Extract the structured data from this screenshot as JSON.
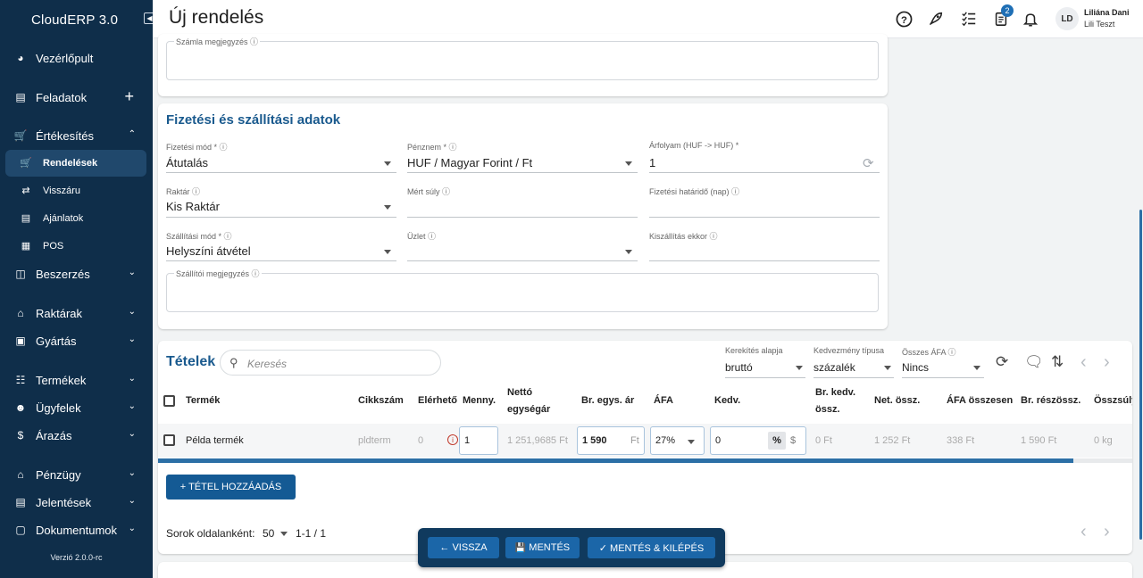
{
  "sidebar": {
    "brand": "CloudERP 3.0",
    "collapse_icon": "collapse-icon",
    "items": [
      {
        "label": "Vezérlőpult",
        "icon": "dashboard-icon"
      },
      {
        "label": "Feladatok",
        "icon": "clipboard-icon"
      },
      {
        "label": "Értékesítés",
        "icon": "cart-icon"
      },
      {
        "label": "Rendelések",
        "icon": "cart-icon"
      },
      {
        "label": "Visszáru",
        "icon": "swap-icon"
      },
      {
        "label": "Ajánlatok",
        "icon": "document-icon"
      },
      {
        "label": "POS",
        "icon": "pos-icon"
      },
      {
        "label": "Beszerzés",
        "icon": "truck-icon"
      },
      {
        "label": "Raktárak",
        "icon": "warehouse-icon"
      },
      {
        "label": "Gyártás",
        "icon": "folder-icon"
      },
      {
        "label": "Termékek",
        "icon": "products-icon"
      },
      {
        "label": "Ügyfelek",
        "icon": "people-icon"
      },
      {
        "label": "Árazás",
        "icon": "dollar-icon"
      },
      {
        "label": "Pénzügy",
        "icon": "bank-icon"
      },
      {
        "label": "Jelentések",
        "icon": "report-icon"
      },
      {
        "label": "Dokumentumok",
        "icon": "file-icon"
      }
    ],
    "version": "Verzió 2.0.0-rc"
  },
  "topbar": {
    "title": "Új rendelés",
    "badge_count": "2",
    "user_initials": "LD",
    "user_name": "Liliána Dani",
    "user_sub": "Lili Teszt"
  },
  "invoice_note": {
    "label": "Számla megjegyzés ⓘ"
  },
  "payment": {
    "title": "Fizetési és szállítási adatok",
    "fields": {
      "payment_method": {
        "label": "Fizetési mód * ⓘ",
        "value": "Átutalás"
      },
      "currency": {
        "label": "Pénznem * ⓘ",
        "value": "HUF / Magyar Forint / Ft"
      },
      "rate": {
        "label": "Árfolyam (HUF -> HUF) *",
        "value": "1"
      },
      "warehouse": {
        "label": "Raktár ⓘ",
        "value": "Kis Raktár"
      },
      "weight": {
        "label": "Mért súly ⓘ",
        "value": ""
      },
      "deadline": {
        "label": "Fizetési határidő (nap) ⓘ",
        "value": ""
      },
      "shipping_method": {
        "label": "Szállítási mód * ⓘ",
        "value": "Helyszíni átvétel"
      },
      "shop": {
        "label": "Üzlet ⓘ",
        "value": ""
      },
      "delivery": {
        "label": "Kiszállítás ekkor ⓘ",
        "value": ""
      },
      "supplier_note": {
        "label": "Szállítói megjegyzés ⓘ"
      }
    }
  },
  "items": {
    "title": "Tételek",
    "search_placeholder": "Keresés",
    "rounding": {
      "label": "Kerekítés alapja",
      "value": "bruttó"
    },
    "discount_type": {
      "label": "Kedvezmény típusa",
      "value": "százalék"
    },
    "total_vat": {
      "label": "Összes ÁFA ⓘ",
      "value": "Nincs"
    },
    "columns": [
      "Termék",
      "Cikkszám",
      "Elérhető",
      "Menny.",
      "Nettó egységár",
      "Br. egys. ár",
      "ÁFA",
      "Kedv.",
      "Br. kedv. össz.",
      "Net. össz.",
      "ÁFA összesen",
      "Br. részössz.",
      "Összsúly"
    ],
    "rows": [
      {
        "product": "Példa termék",
        "sku": "pldterm",
        "available": "0",
        "qty": "1",
        "net_unit": "1 251,9685 Ft",
        "gross_unit": "1 590",
        "gross_unit_suffix": "Ft",
        "vat": "27%",
        "discount": "0",
        "disc_pct": "%",
        "disc_abs": "$",
        "gross_disc_total": "0 Ft",
        "net_total": "1 252 Ft",
        "vat_total": "338 Ft",
        "gross_subtotal": "1 590 Ft",
        "weight": "0 kg"
      }
    ],
    "add_button": "+ TÉTEL HOZZÁADÁS",
    "rows_per_page_label": "Sorok oldalanként:",
    "rows_per_page": "50",
    "range": "1-1 / 1"
  },
  "actions": {
    "back": "← VISSZA",
    "save": "MENTÉS",
    "save_exit": "✓ MENTÉS & KILÉPÉS"
  },
  "colors": {
    "sidebar": "#0f2e4a",
    "accent": "#1a5a8e",
    "button": "#145a94"
  }
}
